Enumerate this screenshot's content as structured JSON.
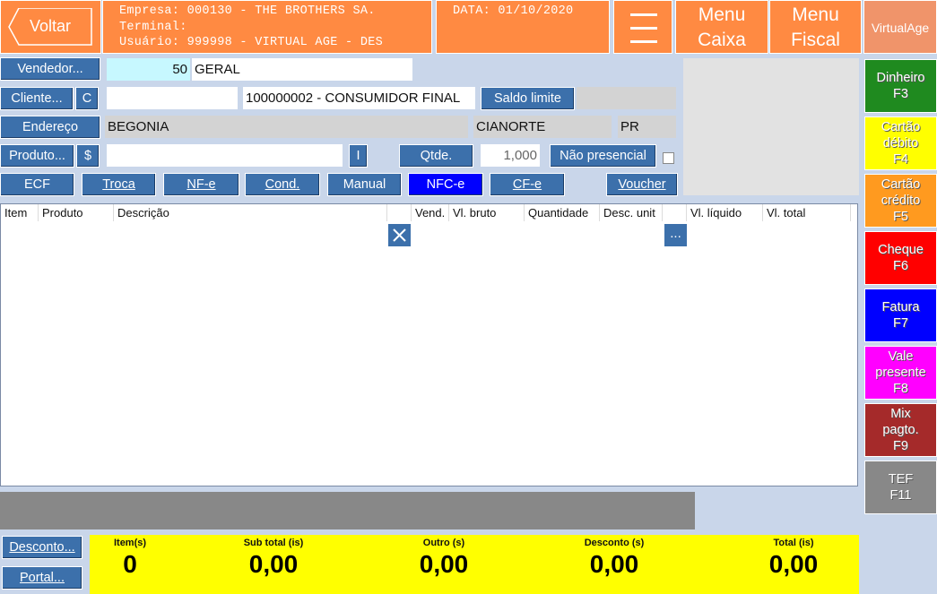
{
  "header": {
    "back_label": "Voltar",
    "empresa": "Empresa: 000130 - THE BROTHERS SA.",
    "terminal": "Terminal:",
    "usuario": "Usuário: 999998 - VIRTUAL AGE - DES",
    "data": "DATA: 01/10/2020",
    "menu_caixa_1": "Menu",
    "menu_caixa_2": "Caixa",
    "menu_fiscal_1": "Menu",
    "menu_fiscal_2": "Fiscal",
    "brand": "VirtualAge"
  },
  "form": {
    "vendedor_label": "Vendedor...",
    "vendedor_code": "50",
    "vendedor_name": "GERAL",
    "cliente_label": "Cliente...",
    "cliente_c": "C",
    "cliente_code": "",
    "cliente_name": "100000002 - CONSUMIDOR FINAL",
    "saldo_label": "Saldo limite",
    "saldo_value": "",
    "endereco_label": "Endereço",
    "endereco_value": "BEGONIA",
    "cidade": "CIANORTE",
    "uf": "PR",
    "produto_label": "Produto...",
    "produto_dollar": "$",
    "produto_value": "",
    "produto_i": "I",
    "qtde_label": "Qtde.",
    "qtde_value": "1,000",
    "nao_presencial_label": "Não presencial"
  },
  "modes": {
    "ecf": "ECF",
    "troca": "Troca",
    "nfe": "NF-e",
    "cond": "Cond.",
    "manual": "Manual",
    "nfce": "NFC-e",
    "cfe": "CF-e",
    "voucher": "Voucher"
  },
  "grid": {
    "columns": [
      "Item",
      "Produto",
      "Descrição",
      "",
      "Vend.",
      "Vl. bruto",
      "Quantidade",
      "Desc. unit",
      "",
      "Vl. líquido",
      "Vl. total"
    ],
    "dots_label": "..."
  },
  "payments": [
    {
      "l1": "Dinheiro",
      "l2": "F3",
      "l3": "",
      "color": "#1f8a1f"
    },
    {
      "l1": "Cartão",
      "l2": "débito",
      "l3": "F4",
      "color": "#ffff00"
    },
    {
      "l1": "Cartão",
      "l2": "crédito",
      "l3": "F5",
      "color": "#ff9a1f"
    },
    {
      "l1": "Cheque",
      "l2": "F6",
      "l3": "",
      "color": "#ff0000"
    },
    {
      "l1": "Fatura",
      "l2": "F7",
      "l3": "",
      "color": "#0000ff"
    },
    {
      "l1": "Vale",
      "l2": "presente",
      "l3": "F8",
      "color": "#ff00ff"
    },
    {
      "l1": "Mix",
      "l2": "pagto.",
      "l3": "F9",
      "color": "#a52a2a"
    },
    {
      "l1": "TEF",
      "l2": "F11",
      "l3": "",
      "color": "#888888"
    }
  ],
  "footer": {
    "desconto_label": "Desconto...",
    "portal_label": "Portal..."
  },
  "totals": {
    "itens_label": "Item(s)",
    "itens_value": "0",
    "subtotal_label": "Sub total (is)",
    "subtotal_value": "0,00",
    "outro_label": "Outro (s)",
    "outro_value": "0,00",
    "desconto_label": "Desconto (s)",
    "desconto_value": "0,00",
    "total_label": "Total (is)",
    "total_value": "0,00"
  }
}
